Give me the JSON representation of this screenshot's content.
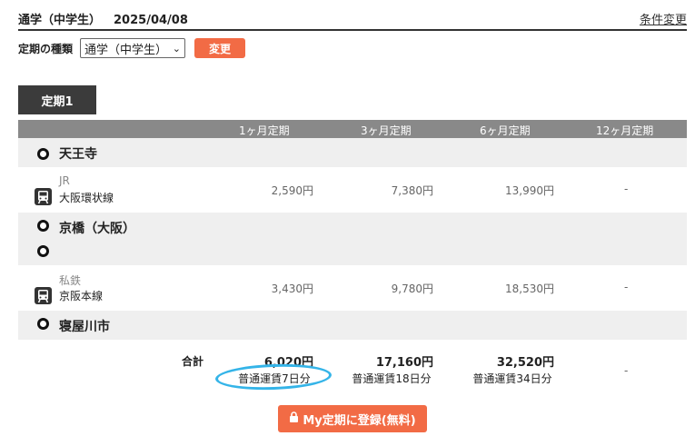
{
  "header": {
    "route_type": "通学（中学生）",
    "date": "2025/04/08",
    "change_conditions_label": "条件変更"
  },
  "type_row": {
    "label": "定期の種類",
    "selected": "通学（中学生）",
    "change_button_label": "変更"
  },
  "tab": {
    "label": "定期1"
  },
  "table": {
    "columns": [
      "1ヶ月定期",
      "3ヶ月定期",
      "6ヶ月定期",
      "12ヶ月定期"
    ],
    "stations": [
      "天王寺",
      "京橋（大阪）",
      "寝屋川市"
    ],
    "segments": [
      {
        "company": "JR",
        "line": "大阪環状線",
        "color": "#e8424a",
        "fares": [
          "2,590円",
          "7,380円",
          "13,990円",
          "-"
        ]
      },
      {
        "company": "私鉄",
        "line": "京阪本線",
        "color": "#f07f2a",
        "fares": [
          "3,430円",
          "9,780円",
          "18,530円",
          "-"
        ]
      }
    ],
    "total": {
      "label": "合計",
      "values": [
        "6,020円",
        "17,160円",
        "32,520円",
        "-"
      ],
      "subs": [
        "普通運賃7日分",
        "普通運賃18日分",
        "普通運賃34日分"
      ]
    }
  },
  "register_button": {
    "label": "My定期に登録(無料)"
  }
}
